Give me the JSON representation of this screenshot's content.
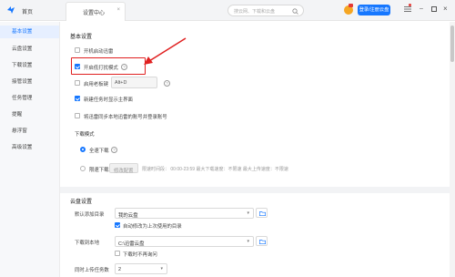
{
  "header": {
    "home_label": "首页",
    "tab_label": "设置中心",
    "tab_close": "×",
    "search_placeholder": "搜云网、下载和云盘",
    "login_label": "登录/注册云盘",
    "min": "–",
    "close": "×"
  },
  "sidebar": {
    "items": [
      {
        "label": "基本设置",
        "active": true
      },
      {
        "label": "云盘设置"
      },
      {
        "label": "下载设置"
      },
      {
        "label": "接管设置"
      },
      {
        "label": "任务管理"
      },
      {
        "label": "提醒"
      },
      {
        "label": "悬浮窗"
      },
      {
        "label": "高级设置"
      }
    ]
  },
  "basic": {
    "title": "基本设置",
    "autostart": "开机启动迅雷",
    "lowkey_mode": "开启低打扰模式",
    "boss_key": "启用老板键",
    "boss_key_value": "Alt+D",
    "show_main_ui": "新建任务时显示主界面",
    "sync_account": "将迅雷同步本地迅雷的账号并登录账号"
  },
  "download_mode": {
    "title": "下载模式",
    "full_speed": "全速下载",
    "limited": "限速下载",
    "modify_config": "修改配置",
    "limit_info": "限速时间段：  00:00-23:59   最大下载速度：不限速   最大上传速度：不限速"
  },
  "cloud": {
    "title": "云盘设置",
    "default_dir_label": "默认添加目录",
    "default_dir_value": "我的云盘",
    "auto_change": "自动修改为上次使用的目录",
    "download_local_label": "下载到本地",
    "download_local_value": "C:\\迅雷云盘",
    "no_ask": "下载时不再询问",
    "upload_tasks_label": "同时上传任务数",
    "upload_tasks_value": "2"
  },
  "colors": {
    "accent": "#1677ff",
    "highlight": "#e02020"
  }
}
